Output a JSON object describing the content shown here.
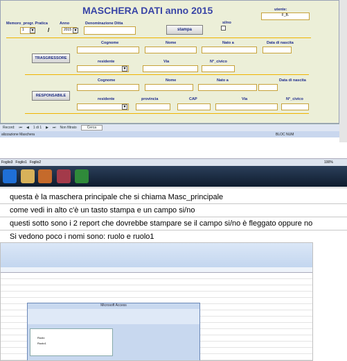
{
  "form": {
    "title": "MASCHERA DATI anno 2015",
    "utente_label": "utente:",
    "utente_value": "F_B.",
    "memoro_label": "Memoro_progr. Pratica",
    "anno_label": "Anno",
    "denom_label": "Denominazione Ditta",
    "prog_value": "1",
    "sep": "/",
    "anno_value": "2015",
    "stampa": "stampa",
    "sino_label": "si/no",
    "trasg_btn": "TRASGRESSORE",
    "resp_btn": "RESPONSABILE",
    "t_headers": [
      "Cognome",
      "Nome",
      "Nato a",
      "Data di nascita"
    ],
    "t_sub": [
      "residente",
      "Via",
      "N°_civico"
    ],
    "r_headers": [
      "Cognome",
      "Nome",
      "Nato a",
      "Data di nascita"
    ],
    "r_sub": [
      "residente",
      "provincia",
      "CAP",
      "Via",
      "N°_civico"
    ]
  },
  "status": {
    "record": "Record:",
    "rec_pos": "1 di 1",
    "filter": "Non filtrato",
    "search": "Cerca",
    "view": "alizzazione Maschera",
    "numlock": "BLOC NUM"
  },
  "sheets": [
    "Foglio3",
    "Foglio1",
    "Foglio2"
  ],
  "zoom": "100%",
  "messages": [
    "questa è la maschera principale che si chiama Masc_principale",
    "come vedi in alto c'è un tasto stampa e un campo si/no",
    "questi sotto sono i 2 report che dovrebbe stampare se il campo si/no è fleggato oppure no",
    "Si vedono poco i nomi sono: ruolo e ruolo1"
  ],
  "inner": {
    "title": "Microsoft Access",
    "items": [
      "Ruolo",
      "Ruolo1"
    ]
  }
}
